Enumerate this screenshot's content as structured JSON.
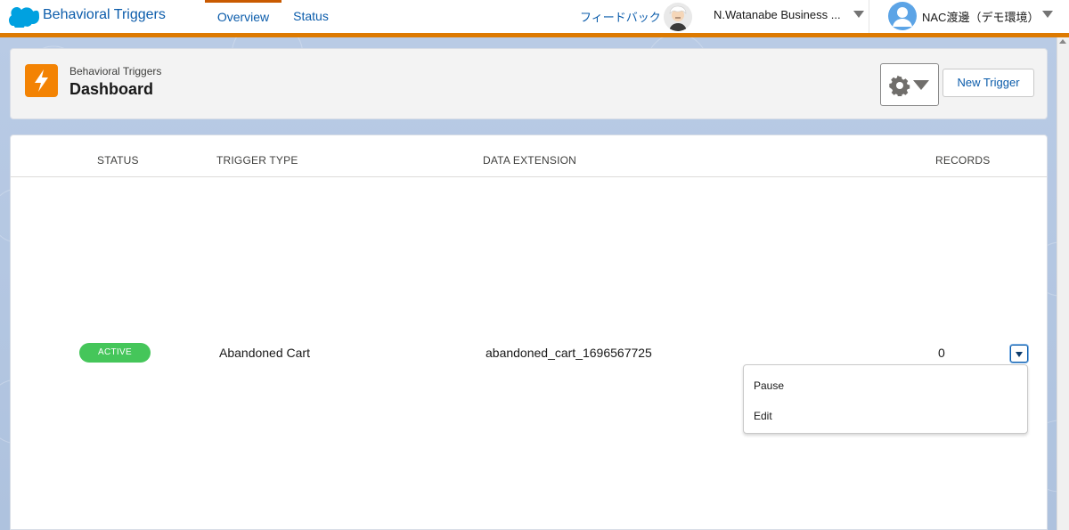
{
  "topbar": {
    "app_name": "Behavioral Triggers",
    "tabs": [
      {
        "label": "Overview",
        "active": true
      },
      {
        "label": "Status",
        "active": false
      }
    ],
    "feedback_label": "フィードバック",
    "org_name": "N.Watanabe Business ...",
    "user_name": "NAC渡邊（デモ環境）"
  },
  "header": {
    "eyebrow": "Behavioral Triggers",
    "title": "Dashboard",
    "new_trigger_label": "New Trigger",
    "icon": "lightning-icon",
    "icon_color": "#f38303"
  },
  "table": {
    "columns": [
      "STATUS",
      "TRIGGER TYPE",
      "DATA EXTENSION",
      "RECORDS"
    ],
    "rows": [
      {
        "status": "ACTIVE",
        "trigger_type": "Abandoned Cart",
        "data_extension": "abandoned_cart_1696567725",
        "records": "0"
      }
    ]
  },
  "row_menu": {
    "items": [
      "Pause",
      "Edit"
    ]
  },
  "colors": {
    "accent": "#0b5cab",
    "brand_bar": "#dd7a01",
    "active_badge": "#45c65a"
  }
}
